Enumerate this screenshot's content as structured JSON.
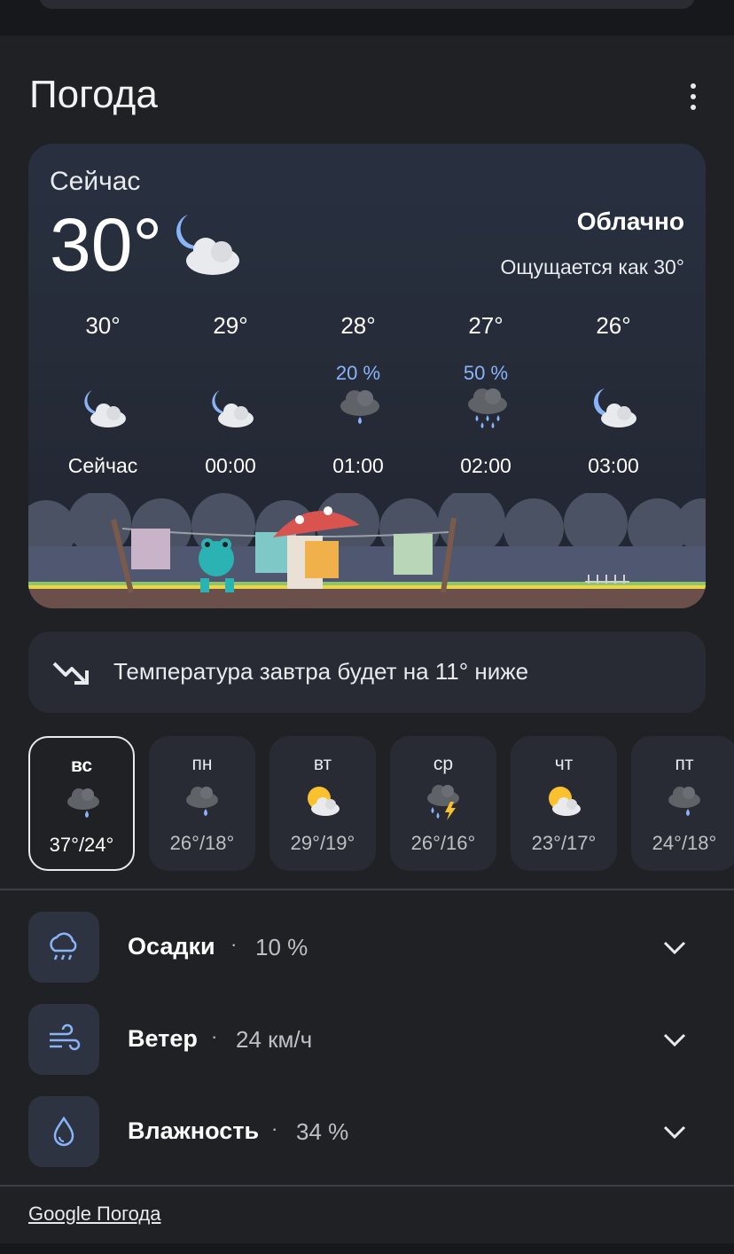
{
  "header": {
    "title": "Погода",
    "menu_icon": "more-vert-icon"
  },
  "current": {
    "label": "Сейчас",
    "temperature": "30°",
    "condition": "Облачно",
    "feels_like": "Ощущается как 30°",
    "icon": "night-partly-cloudy-icon"
  },
  "hourly": [
    {
      "temp": "30°",
      "precip": "",
      "label": "Сейчас",
      "icon": "night-partly-cloudy-icon"
    },
    {
      "temp": "29°",
      "precip": "",
      "label": "00:00",
      "icon": "night-partly-cloudy-icon"
    },
    {
      "temp": "28°",
      "precip": "20 %",
      "label": "01:00",
      "icon": "rain-cloud-icon"
    },
    {
      "temp": "27°",
      "precip": "50 %",
      "label": "02:00",
      "icon": "heavy-rain-cloud-icon"
    },
    {
      "temp": "26°",
      "precip": "",
      "label": "03:00",
      "icon": "night-partly-cloudy-icon"
    }
  ],
  "tomorrow_note": {
    "text": "Температура завтра будет на 11° ниже",
    "icon": "trending-down-icon"
  },
  "daily": [
    {
      "day": "вс",
      "temps": "37°/24°",
      "icon": "rain-cloud-icon",
      "selected": true
    },
    {
      "day": "пн",
      "temps": "26°/18°",
      "icon": "rain-cloud-icon"
    },
    {
      "day": "вт",
      "temps": "29°/19°",
      "icon": "sun-cloud-icon"
    },
    {
      "day": "ср",
      "temps": "26°/16°",
      "icon": "thunderstorm-icon"
    },
    {
      "day": "чт",
      "temps": "23°/17°",
      "icon": "sun-cloud-icon"
    },
    {
      "day": "пт",
      "temps": "24°/18°",
      "icon": "rain-cloud-icon"
    }
  ],
  "details": [
    {
      "label": "Осадки",
      "value": "10 %",
      "icon": "precipitation-icon"
    },
    {
      "label": "Ветер",
      "value": "24 км/ч",
      "icon": "wind-icon"
    },
    {
      "label": "Влажность",
      "value": "34 %",
      "icon": "humidity-icon"
    }
  ],
  "footer": {
    "link": "Google Погода"
  },
  "colors": {
    "background": "#202124",
    "panel": "#282b33",
    "accent_blue": "#8ab4f8",
    "text": "#e8eaed"
  }
}
